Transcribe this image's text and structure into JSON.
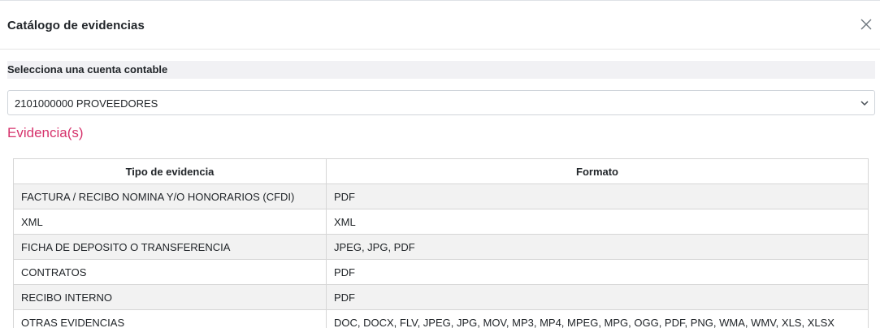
{
  "modal": {
    "title": "Catálogo de evidencias",
    "close_icon": "close-icon"
  },
  "account_select": {
    "label": "Selecciona una cuenta contable",
    "value": "2101000000 PROVEEDORES",
    "chevron_icon": "chevron-down-icon"
  },
  "evidence": {
    "section_title": "Evidencia(s)",
    "section_color": "#d6336c",
    "columns": [
      "Tipo de evidencia",
      "Formato"
    ],
    "rows": [
      {
        "tipo": "FACTURA / RECIBO NOMINA Y/O HONORARIOS (CFDI)",
        "formato": "PDF"
      },
      {
        "tipo": "XML",
        "formato": "XML"
      },
      {
        "tipo": "FICHA DE DEPOSITO O TRANSFERENCIA",
        "formato": "JPEG, JPG, PDF"
      },
      {
        "tipo": "CONTRATOS",
        "formato": "PDF"
      },
      {
        "tipo": "RECIBO INTERNO",
        "formato": "PDF"
      },
      {
        "tipo": "OTRAS EVIDENCIAS",
        "formato": "DOC, DOCX, FLV, JPEG, JPG, MOV, MP3, MP4, MPEG, MPG, OGG, PDF, PNG, WMA, WMV, XLS, XLSX"
      }
    ]
  }
}
